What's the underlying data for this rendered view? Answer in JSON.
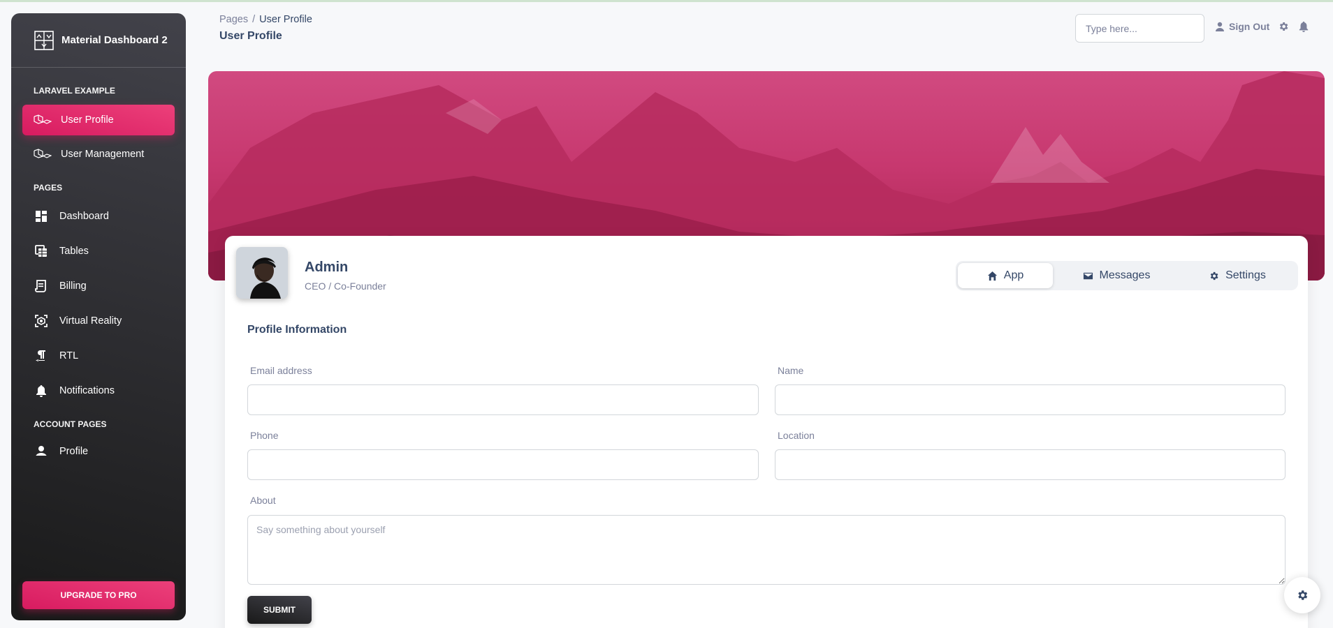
{
  "app": {
    "brand": "Material Dashboard 2",
    "accent_color": "#e91e63",
    "sidebar_dark": "#191919"
  },
  "sidebar": {
    "sections": {
      "laravel": "LARAVEL EXAMPLE",
      "pages": "PAGES",
      "account": "ACCOUNT PAGES"
    },
    "items": [
      {
        "label": "User Profile",
        "icon": "laravel-icon",
        "active": true
      },
      {
        "label": "User Management",
        "icon": "laravel-icon",
        "active": false
      },
      {
        "label": "Dashboard",
        "icon": "dashboard-icon",
        "active": false
      },
      {
        "label": "Tables",
        "icon": "table-icon",
        "active": false
      },
      {
        "label": "Billing",
        "icon": "receipt-icon",
        "active": false
      },
      {
        "label": "Virtual Reality",
        "icon": "view-in-ar-icon",
        "active": false
      },
      {
        "label": "RTL",
        "icon": "format-textdirection-icon",
        "active": false
      },
      {
        "label": "Notifications",
        "icon": "bell-icon",
        "active": false
      },
      {
        "label": "Profile",
        "icon": "person-icon",
        "active": false
      }
    ],
    "upgrade_label": "UPGRADE TO PRO"
  },
  "header": {
    "breadcrumb_root": "Pages",
    "breadcrumb_sep": "/",
    "breadcrumb_current": "User Profile",
    "title": "User Profile",
    "search_placeholder": "Type here...",
    "signout_label": "Sign Out"
  },
  "profile": {
    "name": "Admin",
    "role": "CEO / Co-Founder",
    "tabs": [
      {
        "label": "App",
        "icon": "home-icon",
        "active": true
      },
      {
        "label": "Messages",
        "icon": "email-icon",
        "active": false
      },
      {
        "label": "Settings",
        "icon": "gear-icon",
        "active": false
      }
    ]
  },
  "form": {
    "title": "Profile Information",
    "email_label": "Email address",
    "email_value": "",
    "name_label": "Name",
    "name_value": "",
    "phone_label": "Phone",
    "phone_value": "",
    "location_label": "Location",
    "location_value": "",
    "about_label": "About",
    "about_placeholder": "Say something about yourself",
    "submit_label": "SUBMIT"
  }
}
